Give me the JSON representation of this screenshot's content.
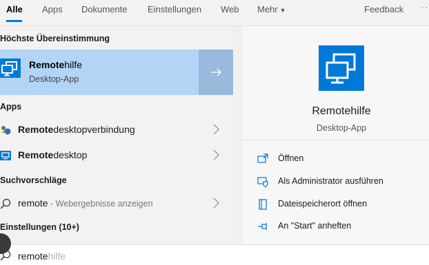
{
  "tabs": {
    "items": [
      {
        "label": "Alle",
        "active": true
      },
      {
        "label": "Apps"
      },
      {
        "label": "Dokumente"
      },
      {
        "label": "Einstellungen"
      },
      {
        "label": "Web"
      },
      {
        "label": "Mehr"
      }
    ],
    "feedback": "Feedback",
    "more_dots": "···"
  },
  "sections": {
    "best_match": "Höchste Übereinstimmung",
    "apps": "Apps",
    "suggestions": "Suchvorschläge",
    "settings": "Einstellungen (10+)"
  },
  "best_match": {
    "title_bold": "Remote",
    "title_rest": "hilfe",
    "subtitle": "Desktop-App",
    "icon": "remote-assistance-icon"
  },
  "apps": [
    {
      "bold": "Remote",
      "rest": "desktopverbindung",
      "icon": "remote-desktop-connection-icon"
    },
    {
      "bold": "Remote",
      "rest": "desktop",
      "icon": "remote-desktop-icon"
    }
  ],
  "suggestion": {
    "query": "remote",
    "hint": " - Webergebnisse anzeigen",
    "icon": "search-icon"
  },
  "detail": {
    "title": "Remotehilfe",
    "subtitle": "Desktop-App",
    "actions": [
      {
        "label": "Öffnen",
        "icon": "open-icon"
      },
      {
        "label": "Als Administrator ausführen",
        "icon": "run-as-admin-icon"
      },
      {
        "label": "Dateispeicherort öffnen",
        "icon": "file-location-icon"
      },
      {
        "label": "An \"Start\" anheften",
        "icon": "pin-icon"
      }
    ]
  },
  "search": {
    "typed": "remote",
    "autocomplete": "hilfe"
  },
  "colors": {
    "accent": "#0078d7",
    "selection": "#b3d4f5",
    "selection_arrow": "#99b9dd"
  }
}
